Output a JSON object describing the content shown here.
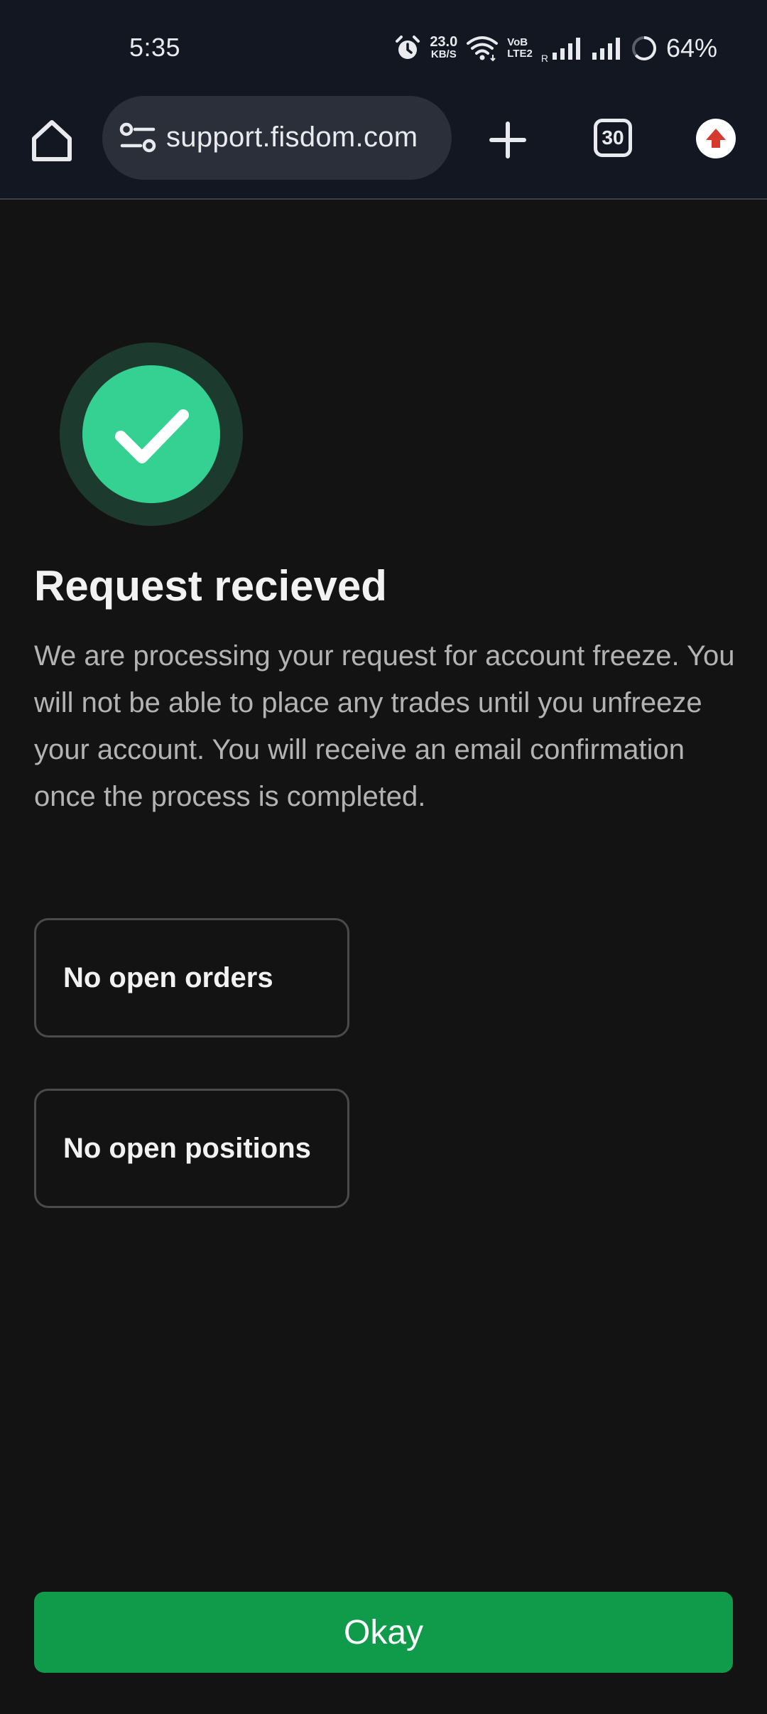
{
  "status_bar": {
    "time": "5:35",
    "net_speed_value": "23.0",
    "net_speed_unit": "KB/S",
    "volte_line1": "VoB",
    "volte_line2": "LTE2",
    "roaming_label": "R",
    "battery": "64%",
    "battery_level": 0.64,
    "icons": [
      "alarm-icon",
      "wifi-icon",
      "signal-sim1-icon",
      "signal-sim2-icon",
      "battery-ring-icon"
    ]
  },
  "browser": {
    "url": "support.fisdom.com",
    "tab_count": "30",
    "icons": [
      "home-icon",
      "site-settings-icon",
      "new-tab-icon",
      "tab-switcher-icon",
      "update-icon"
    ]
  },
  "content": {
    "title": "Request recieved",
    "description": "We are processing your request for account freeze. You will not be able to place any trades until you unfreeze your account. You will receive an email confirmation once the process is completed.",
    "cards": [
      {
        "label": "No open orders"
      },
      {
        "label": "No open positions"
      }
    ],
    "button_label": "Okay"
  },
  "colors": {
    "background": "#131313",
    "bar_background": "#121722",
    "success_green": "#34d193",
    "button_green": "#109b4a",
    "update_red": "#d63a2f"
  }
}
